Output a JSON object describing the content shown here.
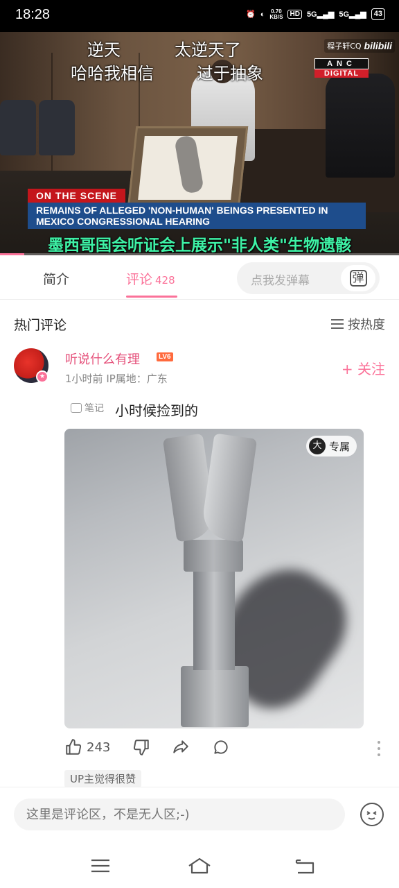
{
  "status_bar": {
    "time": "18:28",
    "net_speed_value": "0.70",
    "net_speed_unit": "KB/S",
    "hd_label": "HD",
    "signal1": "5G",
    "signal2": "5G",
    "battery": "43"
  },
  "video": {
    "danmaku": [
      "逆天",
      "太逆天了",
      "哈哈我相信",
      "过于抽象"
    ],
    "watermark_user": "程子轩CQ",
    "watermark_logo": "bilibili",
    "anc_top": "ANC",
    "anc_bottom": "DIGITAL",
    "on_scene": "ON THE SCENE",
    "headline_line1": "REMAINS OF ALLEGED 'NON-HUMAN' BEINGS PRESENTED IN",
    "headline_line2": "MEXICO CONGRESSIONAL HEARING",
    "caption": "墨西哥国会听证会上展示\"非人类\"生物遗骸",
    "progress": 0.06
  },
  "tabs": {
    "intro": "简介",
    "comments": "评论",
    "comment_count": "428",
    "danmaku_placeholder": "点我发弹幕",
    "danmaku_btn": "弹"
  },
  "section": {
    "title": "热门评论",
    "sort": "按热度"
  },
  "comment": {
    "user": "听说什么有理",
    "level": "LV6",
    "time": "1小时前",
    "ip": "IP属地：广东",
    "follow": "+ 关注",
    "note_tag": "笔记",
    "text": "小时候捡到的",
    "exclusive_icon": "大",
    "exclusive_label": "专属",
    "likes": "243",
    "up_tag": "UP主觉得很赞"
  },
  "input": {
    "placeholder": "这里是评论区，不是无人区;-)"
  },
  "colors": {
    "accent": "#fb7299",
    "caption": "#3ef2a6",
    "headline_bg": "#1e4d8c",
    "on_scene_bg": "#c4161c"
  }
}
